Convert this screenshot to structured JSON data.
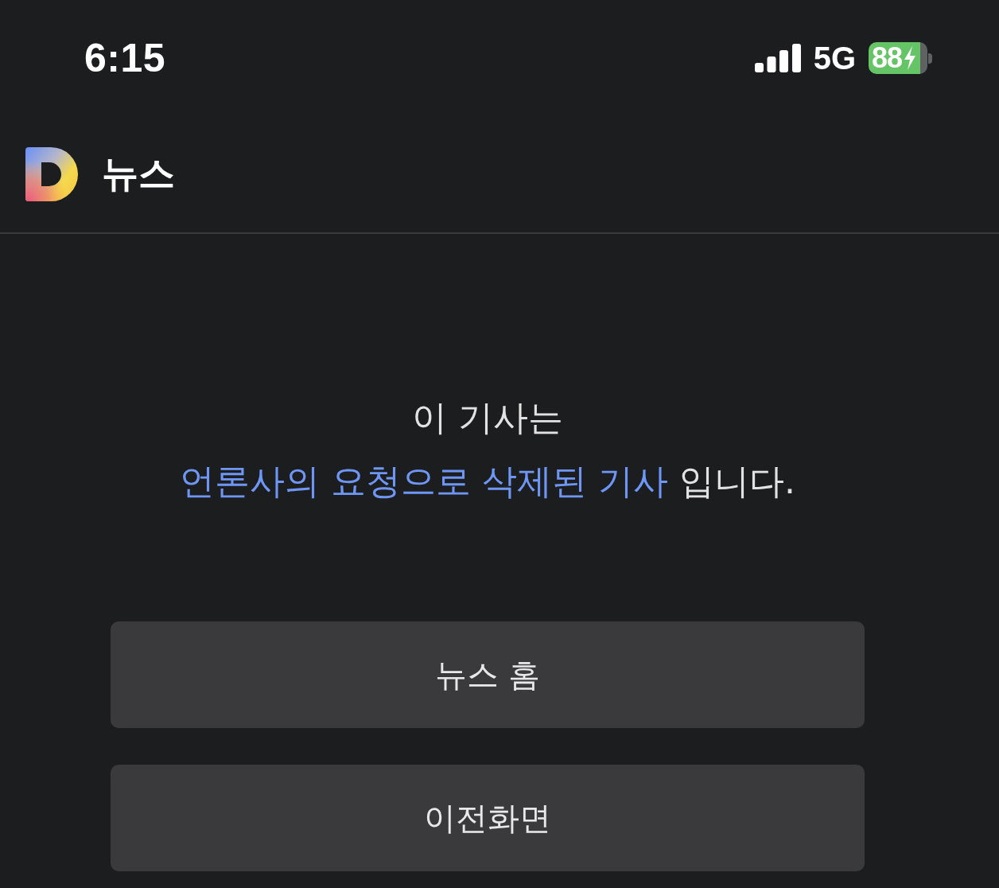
{
  "status_bar": {
    "time": "6:15",
    "network": "5G",
    "battery": {
      "percentage": "88",
      "charging": true
    }
  },
  "header": {
    "title": "뉴스"
  },
  "message": {
    "lines": [
      [
        {
          "text": "이 기사는",
          "highlighted": false
        }
      ],
      [
        {
          "text": "언론사의 요청으로 삭제된 기사",
          "highlighted": true
        },
        {
          "text": " 입니다.",
          "highlighted": false
        }
      ]
    ]
  },
  "buttons": [
    {
      "label": "뉴스 홈"
    },
    {
      "label": "이전화면"
    }
  ]
}
